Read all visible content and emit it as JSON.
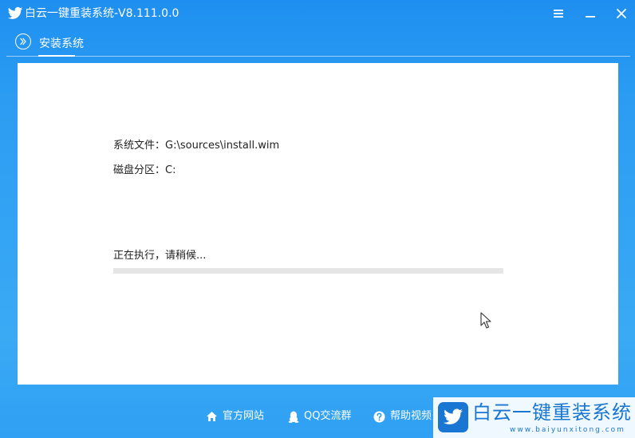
{
  "app": {
    "title": "白云一键重装系统-V8.111.0.0"
  },
  "window_controls": {
    "menu": "menu-icon",
    "minimize": "minimize-icon",
    "close": "close-icon"
  },
  "nav": {
    "active_tab": "安装系统"
  },
  "install": {
    "system_file_label": "系统文件：",
    "system_file_value": "G:\\sources\\install.wim",
    "disk_partition_label": "磁盘分区：",
    "disk_partition_value": "C:",
    "status_text": "正在执行，请稍候...",
    "progress_fraction": 0.0
  },
  "footer": {
    "items": [
      {
        "label": "官方网站",
        "icon": "home-icon"
      },
      {
        "label": "QQ交流群",
        "icon": "qq-penguin-icon"
      },
      {
        "label": "帮助视频",
        "icon": "help-circle-icon"
      }
    ]
  },
  "watermark": {
    "title": "白云一键重装系统",
    "url": "www.baiyunxitong.com"
  },
  "colors": {
    "brand_blue": "#2b9cf2",
    "progress_track": "#e6e6e6",
    "watermark_blue": "#1976d2"
  }
}
